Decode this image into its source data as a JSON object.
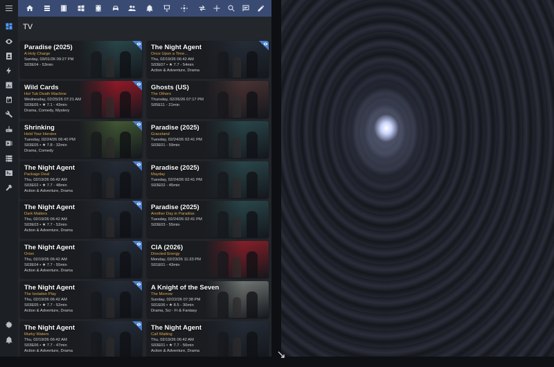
{
  "topbar": {
    "icons": [
      "menu-icon",
      "home-icon",
      "list-icon",
      "film-icon",
      "windows-icon",
      "video-icon",
      "car-icon",
      "people-icon",
      "bell-icon",
      "presentation-icon",
      "gamepad-icon",
      "transfer-icon",
      "plus-icon",
      "search-icon",
      "message-icon",
      "pencil-icon"
    ]
  },
  "sidebar": {
    "icons": [
      "dashboard-icon",
      "eye-icon",
      "contacts-icon",
      "lightning-icon",
      "chart-icon",
      "calendar-icon",
      "wrench-icon",
      "router-icon",
      "media-icon",
      "server-icon",
      "terminal-icon",
      "hammer-icon",
      "gear-icon",
      "notification-bell-icon"
    ]
  },
  "page": {
    "title": "TV"
  },
  "cards": [
    {
      "title": "Paradise (2025)",
      "subtitle": "A Holy Charge",
      "line1": "Sunday, 03/01/26 09:27 PM",
      "line2": "S03E04 - 53min",
      "line3": "",
      "watched": true,
      "thumb": "#2f5458"
    },
    {
      "title": "The Night Agent",
      "subtitle": "Once Upon a Time...",
      "line1": "Thu, 02/19/26 06:42 AM",
      "line2": "S03E07 • ★ 7.7 - 54min",
      "line3": "Action & Adventure, Drama",
      "watched": true,
      "thumb": "#2a3340"
    },
    {
      "title": "Wild Cards",
      "subtitle": "Hot Tub Death Machine",
      "line1": "Wednesday, 02/25/26 07:21 AM",
      "line2": "S03E05 • ★ 7.1 - 43min",
      "line3": "Drama, Comedy, Mystery",
      "watched": true,
      "thumb": "#b8182a"
    },
    {
      "title": "Ghosts (US)",
      "subtitle": "The Others",
      "line1": "Thursday, 02/26/26 07:17 PM",
      "line2": "S05E11 - 21min",
      "line3": "",
      "watched": false,
      "thumb": "#5a3a3a"
    },
    {
      "title": "Shrinking",
      "subtitle": "Hold Your Horsies",
      "line1": "Tuesday, 02/24/26 06:40 PM",
      "line2": "S03E05 • ★ 7.8 - 32min",
      "line3": "Drama, Comedy",
      "watched": true,
      "thumb": "#4f6b3a"
    },
    {
      "title": "Paradise (2025)",
      "subtitle": "Graceland",
      "line1": "Tuesday, 02/24/26 02:41 PM",
      "line2": "S03E01 - 59min",
      "line3": "",
      "watched": false,
      "thumb": "#2f5458"
    },
    {
      "title": "The Night Agent",
      "subtitle": "Package Deal",
      "line1": "Thu, 02/19/26 06:42 AM",
      "line2": "S03E02 • ★ 7.7 - 48min",
      "line3": "Action & Adventure, Drama",
      "watched": true,
      "thumb": "#2a3340"
    },
    {
      "title": "Paradise (2025)",
      "subtitle": "Mayday",
      "line1": "Tuesday, 02/24/26 02:41 PM",
      "line2": "S03E02 - 45min",
      "line3": "",
      "watched": false,
      "thumb": "#2f5458"
    },
    {
      "title": "The Night Agent",
      "subtitle": "Dark Matters",
      "line1": "Thu, 02/19/26 06:42 AM",
      "line2": "S03E03 • ★ 7.7 - 52min",
      "line3": "Action & Adventure, Drama",
      "watched": true,
      "thumb": "#2a3340"
    },
    {
      "title": "Paradise (2025)",
      "subtitle": "Another Day in Paradise",
      "line1": "Tuesday, 02/24/26 02:41 PM",
      "line2": "S03E03 - 55min",
      "line3": "",
      "watched": false,
      "thumb": "#2f5458"
    },
    {
      "title": "The Night Agent",
      "subtitle": "Orion",
      "line1": "Thu, 02/19/26 06:42 AM",
      "line2": "S03E04 • ★ 7.7 - 55min",
      "line3": "Action & Adventure, Drama",
      "watched": true,
      "thumb": "#2a3340"
    },
    {
      "title": "CIA (2026)",
      "subtitle": "Directed Energy",
      "line1": "Monday, 02/23/26 11:33 PM",
      "line2": "S01E01 - 43min",
      "line3": "",
      "watched": false,
      "thumb": "#a8202c"
    },
    {
      "title": "The Night Agent",
      "subtitle": "The Isolation Play",
      "line1": "Thu, 02/19/26 06:42 AM",
      "line2": "S03E05 • ★ 7.7 - 52min",
      "line3": "Action & Adventure, Drama",
      "watched": true,
      "thumb": "#2a3340"
    },
    {
      "title": "A Knight of the Seven",
      "subtitle": "The Morrow",
      "line1": "Sunday, 02/22/26 07:38 PM",
      "line2": "S01E06 • ★ 8.5 - 30min",
      "line3": "Drama, Sci - Fi & Fantasy",
      "watched": false,
      "thumb": "#8a8f8a"
    },
    {
      "title": "The Night Agent",
      "subtitle": "Murky Waters",
      "line1": "Thu, 02/19/26 06:42 AM",
      "line2": "S03E06 • ★ 7.7 - 47min",
      "line3": "Action & Adventure, Drama",
      "watched": true,
      "thumb": "#2a3340"
    },
    {
      "title": "The Night Agent",
      "subtitle": "Call Waiting",
      "line1": "Thu, 02/19/26 06:42 AM",
      "line2": "S03E01 • ★ 7.7 - 56min",
      "line3": "Action & Adventure, Drama",
      "watched": false,
      "thumb": "#2a3340"
    }
  ]
}
